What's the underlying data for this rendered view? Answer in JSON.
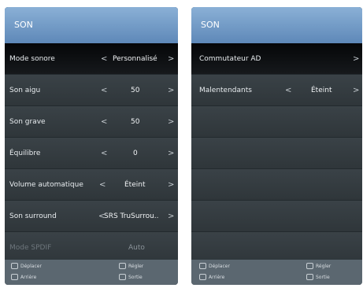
{
  "left": {
    "title": "SON",
    "rows": [
      {
        "label": "Mode sonore",
        "value": "Personnalisé"
      },
      {
        "label": "Son aigu",
        "value": "50"
      },
      {
        "label": "Son grave",
        "value": "50"
      },
      {
        "label": "Équilibre",
        "value": "0"
      },
      {
        "label": "Volume automatique",
        "value": "Éteint"
      },
      {
        "label": "Son surround",
        "value": "SRS TruSurrou.."
      },
      {
        "label": "Mode SPDIF",
        "value": "Auto"
      }
    ],
    "footer": {
      "move": "Déplacer",
      "adjust": "Régler",
      "back": "Arrière",
      "exit": "Sortie"
    }
  },
  "right": {
    "title": "SON",
    "rows": [
      {
        "label": "Commutateur AD"
      },
      {
        "label": "Malentendants",
        "value": "Éteint"
      }
    ],
    "footer": {
      "move": "Déplacer",
      "adjust": "Régler",
      "back": "Arrière",
      "exit": "Sortie"
    }
  },
  "icons": {
    "left": "chevron-left",
    "right": "chevron-right"
  }
}
